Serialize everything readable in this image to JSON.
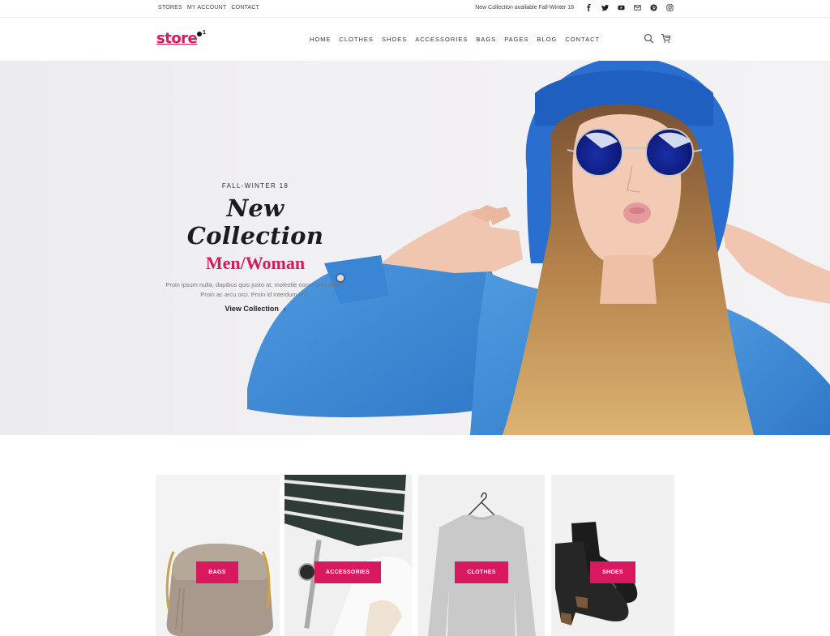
{
  "topbar": {
    "links": [
      "Stores",
      "My Account",
      "Contact"
    ],
    "announcement": "New Collection available Fall-Winter 18",
    "social": [
      "facebook-icon",
      "twitter-icon",
      "youtube-icon",
      "email-icon",
      "pinterest-icon",
      "instagram-icon"
    ]
  },
  "header": {
    "logo": "store",
    "logo_sup": "1",
    "nav": [
      "Home",
      "Clothes",
      "Shoes",
      "Accessories",
      "Bags",
      "Pages",
      "Blog",
      "Contact"
    ],
    "icons": [
      "search-icon",
      "cart-icon"
    ]
  },
  "hero": {
    "eyebrow": "FALL-WINTER 18",
    "title": "New Collection",
    "subtitle": "Men/Woman",
    "description": "Proin ipsum nulla, dapibus quis justo at, molestie consequat turpis. Proin ac arcu orci. Proin id interdum orci.",
    "cta": "View Collection",
    "cta_icon": "›"
  },
  "categories": [
    {
      "label": "Bags"
    },
    {
      "label": "Accessories"
    },
    {
      "label": "Clothes"
    },
    {
      "label": "Shoes"
    }
  ],
  "colors": {
    "accent": "#d8185f",
    "text": "#222222"
  }
}
